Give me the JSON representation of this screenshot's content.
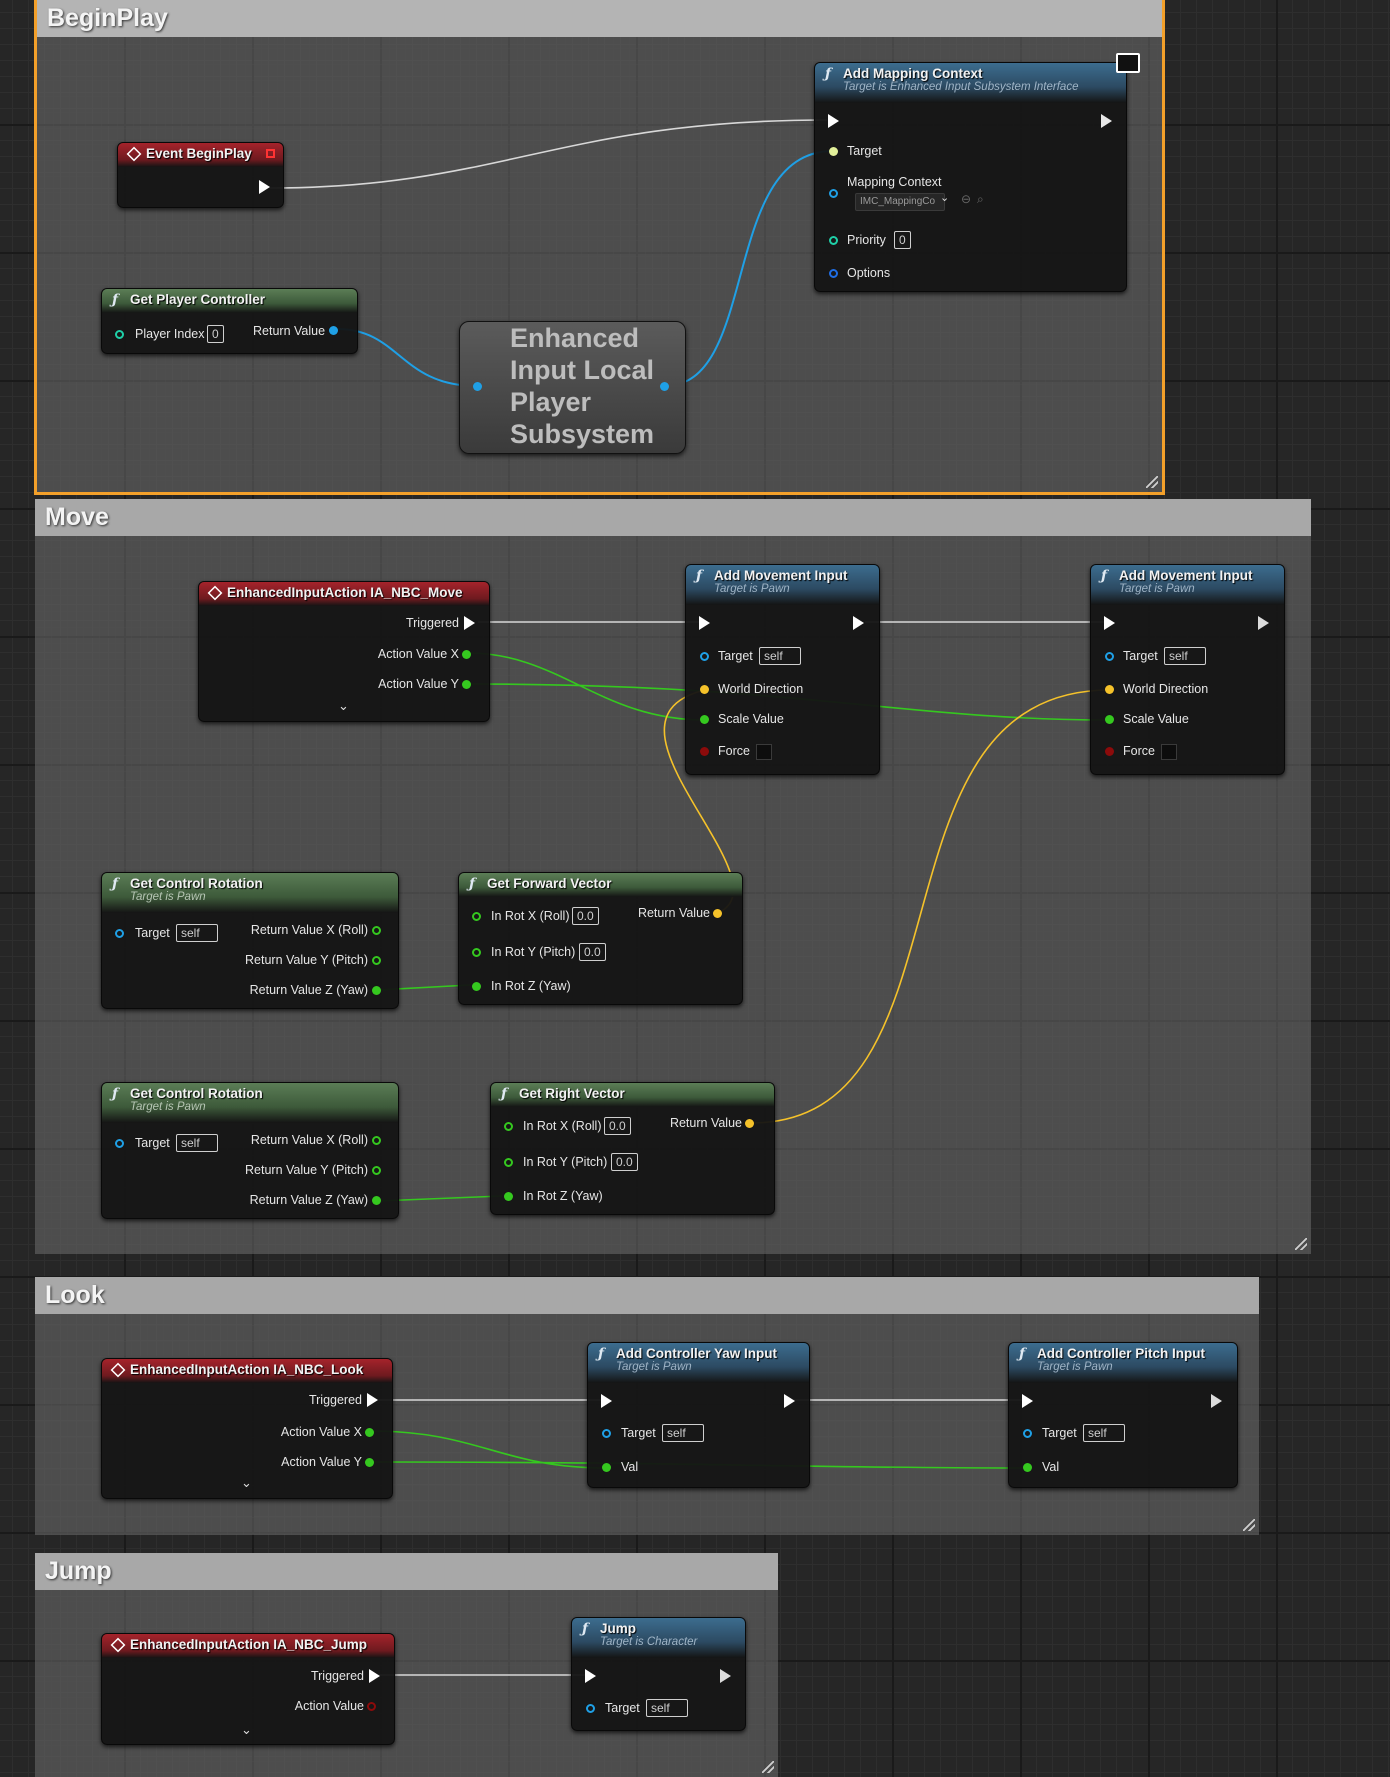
{
  "comments": {
    "beginplay": "BeginPlay",
    "move": "Move",
    "look": "Look",
    "jump": "Jump"
  },
  "event_beginplay": {
    "title": "Event BeginPlay"
  },
  "get_player_controller": {
    "title": "Get Player Controller",
    "player_index_label": "Player Index",
    "player_index_value": "0",
    "return_label": "Return Value"
  },
  "subsystem": {
    "line1": "Enhanced",
    "line2": "Input Local",
    "line3": "Player",
    "line4": "Subsystem"
  },
  "add_mapping_context": {
    "title": "Add Mapping Context",
    "subtitle": "Target is Enhanced Input Subsystem Interface",
    "target_label": "Target",
    "mapping_label": "Mapping Context",
    "mapping_value": "IMC_MappingCo",
    "priority_label": "Priority",
    "priority_value": "0",
    "options_label": "Options"
  },
  "ia_move": {
    "title": "EnhancedInputAction IA_NBC_Move",
    "triggered": "Triggered",
    "axv": "Action Value X",
    "ayv": "Action Value Y"
  },
  "add_move_1": {
    "title": "Add Movement Input",
    "subtitle": "Target is Pawn",
    "target": "Target",
    "self": "self",
    "world": "World Direction",
    "scale": "Scale Value",
    "force": "Force"
  },
  "add_move_2": {
    "title": "Add Movement Input",
    "subtitle": "Target is Pawn",
    "target": "Target",
    "self": "self",
    "world": "World Direction",
    "scale": "Scale Value",
    "force": "Force"
  },
  "gcr1": {
    "title": "Get Control Rotation",
    "subtitle": "Target is Pawn",
    "target": "Target",
    "self": "self",
    "rx": "Return Value X (Roll)",
    "ry": "Return Value Y (Pitch)",
    "rz": "Return Value Z (Yaw)"
  },
  "gcr2": {
    "title": "Get Control Rotation",
    "subtitle": "Target is Pawn",
    "target": "Target",
    "self": "self",
    "rx": "Return Value X (Roll)",
    "ry": "Return Value Y (Pitch)",
    "rz": "Return Value Z (Yaw)"
  },
  "gfv": {
    "title": "Get Forward Vector",
    "inx": "In Rot X (Roll)",
    "inx_val": "0.0",
    "iny": "In Rot Y (Pitch)",
    "iny_val": "0.0",
    "inz": "In Rot Z (Yaw)",
    "ret": "Return Value"
  },
  "grv": {
    "title": "Get Right Vector",
    "inx": "In Rot X (Roll)",
    "inx_val": "0.0",
    "iny": "In Rot Y (Pitch)",
    "iny_val": "0.0",
    "inz": "In Rot Z (Yaw)",
    "ret": "Return Value"
  },
  "ia_look": {
    "title": "EnhancedInputAction IA_NBC_Look",
    "triggered": "Triggered",
    "axv": "Action Value X",
    "ayv": "Action Value Y"
  },
  "yaw": {
    "title": "Add Controller Yaw Input",
    "subtitle": "Target is Pawn",
    "target": "Target",
    "self": "self",
    "val": "Val"
  },
  "pitch": {
    "title": "Add Controller Pitch Input",
    "subtitle": "Target is Pawn",
    "target": "Target",
    "self": "self",
    "val": "Val"
  },
  "ia_jump": {
    "title": "EnhancedInputAction IA_NBC_Jump",
    "triggered": "Triggered",
    "av": "Action Value"
  },
  "jump": {
    "title": "Jump",
    "subtitle": "Target is Character",
    "target": "Target",
    "self": "self"
  },
  "colors": {
    "exec": "#ffffff",
    "object": "#1fa0e6",
    "float": "#35c81f",
    "vector": "#f5c22a",
    "bool": "#8c0b0b",
    "selection": "#f3a02a"
  }
}
